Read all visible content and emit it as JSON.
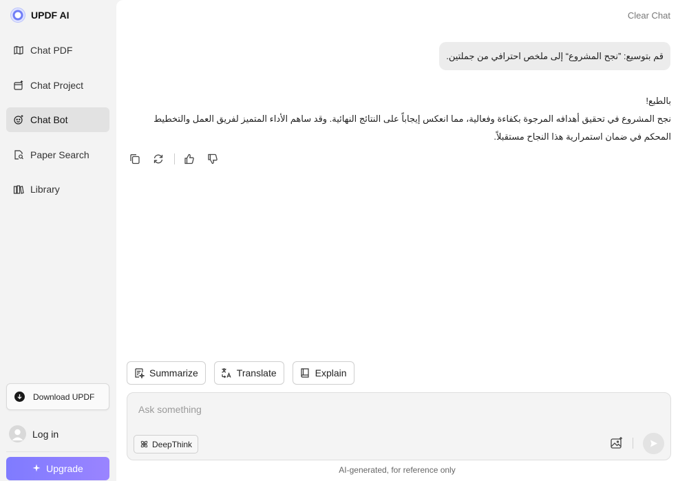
{
  "brand": {
    "name": "UPDF AI"
  },
  "sidebar": {
    "items": [
      {
        "label": "Chat PDF",
        "icon": "chat-pdf-icon"
      },
      {
        "label": "Chat Project",
        "icon": "chat-project-icon"
      },
      {
        "label": "Chat Bot",
        "icon": "chat-bot-icon",
        "active": true
      },
      {
        "label": "Paper Search",
        "icon": "paper-search-icon"
      },
      {
        "label": "Library",
        "icon": "library-icon"
      }
    ],
    "download_label": "Download UPDF",
    "login_label": "Log in",
    "upgrade_label": "Upgrade"
  },
  "header": {
    "clear_chat": "Clear Chat"
  },
  "chat": {
    "user_message": "قم بتوسيع: ”نجح المشروع“ إلى ملخص احترافي من جملتين.",
    "bot_lines": [
      "بالطبع!",
      "نجح المشروع في تحقيق أهدافه المرجوة بكفاءة وفعالية، مما انعكس إيجاباً على النتائج النهائية. وقد ساهم الأداء المتميز لفريق العمل والتخطيط المحكم في ضمان استمرارية هذا النجاح مستقبلاً."
    ]
  },
  "quick_actions": {
    "summarize": "Summarize",
    "translate": "Translate",
    "explain": "Explain"
  },
  "composer": {
    "placeholder": "Ask something",
    "value": "",
    "deepthink_label": "DeepThink"
  },
  "footer": {
    "note": "AI-generated, for reference only"
  },
  "colors": {
    "accent": "#8e7cff",
    "sidebar_bg": "#f3f3f3",
    "active_item_bg": "#e2e2e2"
  }
}
